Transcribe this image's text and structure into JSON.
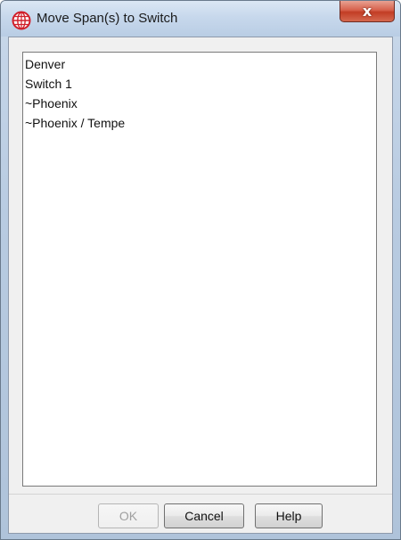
{
  "window": {
    "title": "Move Span(s) to Switch",
    "close_glyph": "x",
    "icon": "red-globe-icon"
  },
  "list": {
    "items": [
      "Denver",
      "Switch 1",
      "~Phoenix",
      "~Phoenix / Tempe"
    ]
  },
  "buttons": {
    "ok_label": "OK",
    "ok_enabled": false,
    "cancel_label": "Cancel",
    "help_label": "Help"
  },
  "colors": {
    "title_gradient_top": "#dbe7f4",
    "close_button_red": "#c23d25",
    "icon_red": "#d01f2a"
  }
}
